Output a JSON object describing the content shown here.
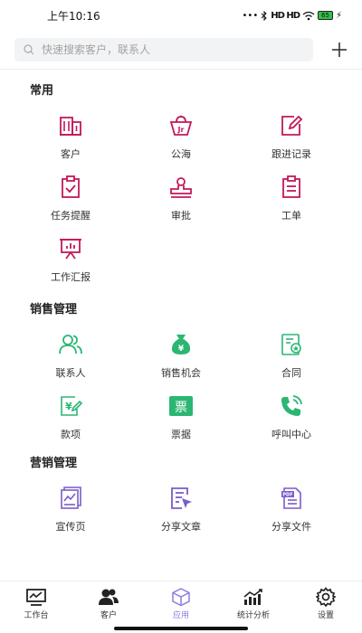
{
  "status": {
    "time": "上午10:16",
    "signal": "HD HD",
    "battery": "65"
  },
  "search": {
    "placeholder": "快速搜索客户，联系人"
  },
  "sections": [
    {
      "title": "常用",
      "items": [
        {
          "label": "客户",
          "icon": "building-icon"
        },
        {
          "label": "公海",
          "icon": "basket-icon"
        },
        {
          "label": "跟进记录",
          "icon": "edit-icon"
        },
        {
          "label": "任务提醒",
          "icon": "clipboard-check-icon"
        },
        {
          "label": "审批",
          "icon": "stamp-icon"
        },
        {
          "label": "工单",
          "icon": "document-list-icon"
        },
        {
          "label": "工作汇报",
          "icon": "presentation-board-icon"
        }
      ]
    },
    {
      "title": "销售管理",
      "items": [
        {
          "label": "联系人",
          "icon": "contacts-icon"
        },
        {
          "label": "销售机会",
          "icon": "money-bag-icon"
        },
        {
          "label": "合同",
          "icon": "contract-icon"
        },
        {
          "label": "款项",
          "icon": "payment-icon"
        },
        {
          "label": "票据",
          "icon": "invoice-icon"
        },
        {
          "label": "呼叫中心",
          "icon": "phone-call-icon"
        }
      ]
    },
    {
      "title": "营销管理",
      "items": [
        {
          "label": "宣传页",
          "icon": "flyer-icon"
        },
        {
          "label": "分享文章",
          "icon": "share-article-icon"
        },
        {
          "label": "分享文件",
          "icon": "pdf-file-icon"
        }
      ]
    }
  ],
  "tabbar": [
    {
      "label": "工作台",
      "icon": "monitor-icon",
      "active": false
    },
    {
      "label": "客户",
      "icon": "users-icon",
      "active": false
    },
    {
      "label": "应用",
      "icon": "cube-icon",
      "active": true
    },
    {
      "label": "统计分析",
      "icon": "bar-chart-icon",
      "active": false
    },
    {
      "label": "设置",
      "icon": "gear-icon",
      "active": false
    }
  ],
  "colors": {
    "magenta": "#c2185b",
    "green": "#2bb673",
    "purple": "#7a5cc8",
    "active_tab": "#8a7ee0"
  }
}
